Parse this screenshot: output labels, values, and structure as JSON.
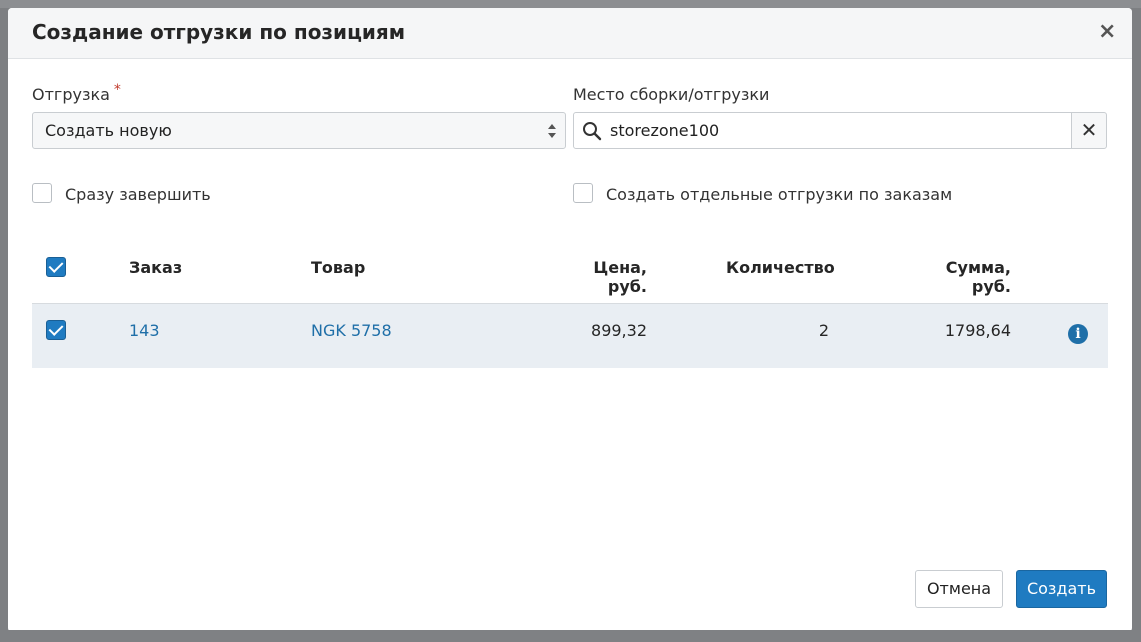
{
  "modal": {
    "title": "Создание отгрузки по позициям",
    "close_symbol": "×"
  },
  "form": {
    "shipment_label": "Отгрузка",
    "required_mark": "*",
    "shipment_value": "Создать новую",
    "location_label": "Место сборки/отгрузки",
    "location_value": "storezone100",
    "clear_symbol": "✕",
    "complete_now_label": "Сразу завершить",
    "complete_now_checked": false,
    "separate_by_orders_label": "Создать отдельные отгрузки по заказам",
    "separate_by_orders_checked": false
  },
  "table": {
    "select_all_checked": true,
    "columns": [
      "Заказ",
      "Товар",
      "Цена, руб.",
      "Количество",
      "Сумма, руб."
    ],
    "rows": [
      {
        "checked": true,
        "order": "143",
        "product": "NGK 5758",
        "price": "899,32",
        "quantity": "2",
        "sum": "1798,64"
      }
    ]
  },
  "footer": {
    "cancel_label": "Отмена",
    "create_label": "Создать"
  },
  "colors": {
    "primary": "#1f7bc1",
    "link": "#1f6fa8",
    "row_highlight": "#e9eef3"
  }
}
